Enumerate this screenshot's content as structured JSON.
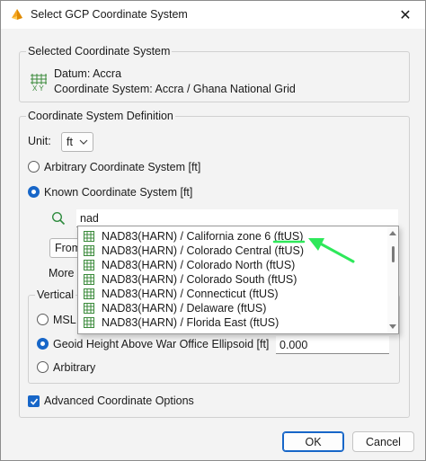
{
  "window": {
    "title": "Select GCP Coordinate System",
    "close_glyph": "✕"
  },
  "selected_cs": {
    "group_title": "Selected Coordinate System",
    "datum": "Datum: Accra",
    "coordinate_system": "Coordinate System: Accra / Ghana National Grid",
    "icon_caption": "XY"
  },
  "cs_definition": {
    "group_title": "Coordinate System Definition",
    "unit_label": "Unit:",
    "unit_value": "ft",
    "arbitrary_label": "Arbitrary Coordinate System [ft]",
    "known_label": "Known Coordinate System [ft]",
    "search_value": "nad",
    "from_button_partial": "From",
    "more_partial": "More"
  },
  "search_results": [
    "NAD83(HARN) / California zone 6 (ftUS)",
    "NAD83(HARN) / Colorado Central (ftUS)",
    "NAD83(HARN) / Colorado North (ftUS)",
    "NAD83(HARN) / Colorado South (ftUS)",
    "NAD83(HARN) / Connecticut (ftUS)",
    "NAD83(HARN) / Delaware (ftUS)",
    "NAD83(HARN) / Florida East (ftUS)"
  ],
  "vertical": {
    "group_title_partial": "Vertical",
    "msl_partial": "MSL",
    "geoid_label": "Geoid Height Above War Office Ellipsoid [ft]",
    "geoid_value": "0.000",
    "arbitrary_label": "Arbitrary"
  },
  "advanced": {
    "label": "Advanced Coordinate Options",
    "checked": true
  },
  "buttons": {
    "ok": "OK",
    "cancel": "Cancel"
  },
  "colors": {
    "accent": "#1766c8",
    "annotation": "#2ee85a",
    "grid_icon": "#3a8a3a"
  },
  "annotation": {
    "type": "arrow",
    "color": "#2ee85a"
  }
}
